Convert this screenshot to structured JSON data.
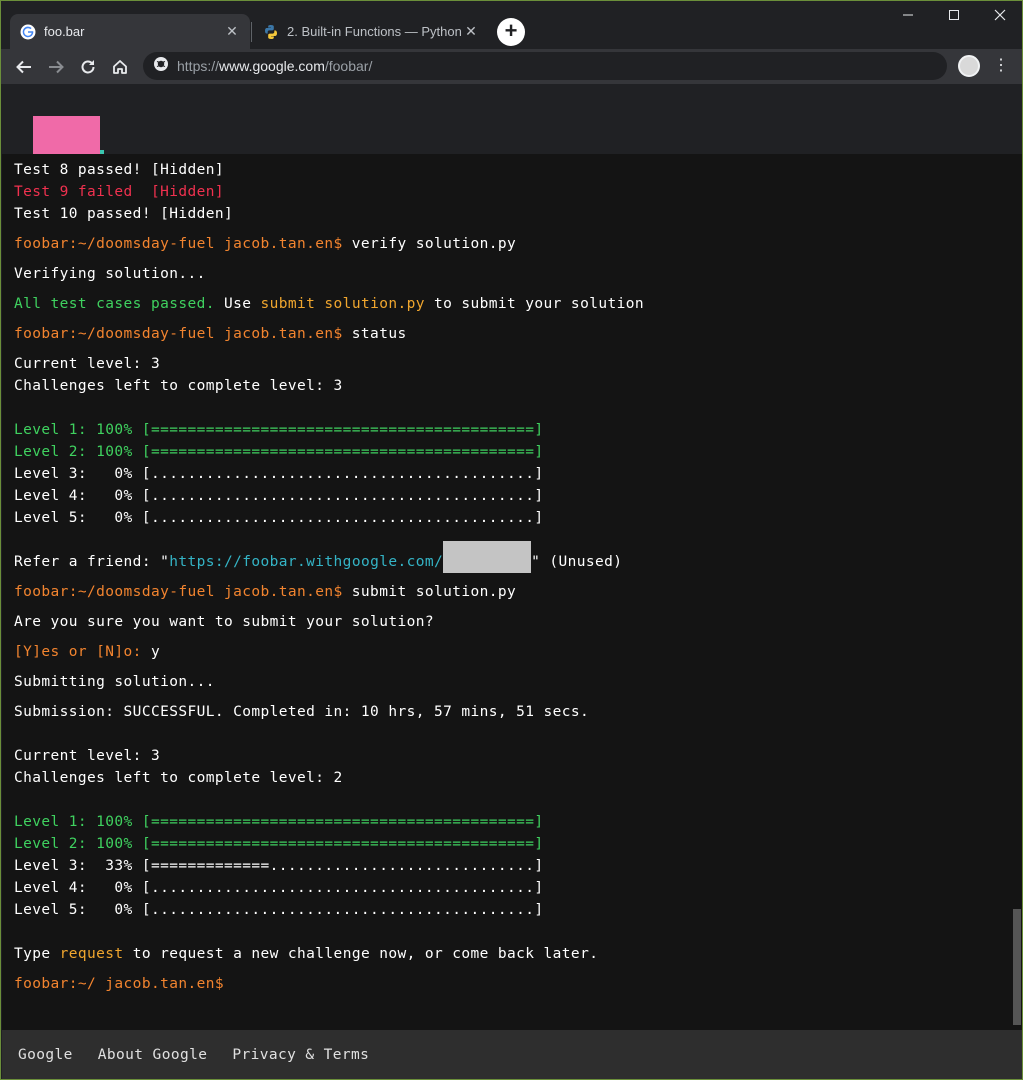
{
  "browser": {
    "tabs": [
      {
        "title": "foo.bar",
        "icon": "google-g-icon",
        "active": true
      },
      {
        "title": "2. Built-in Functions — Python 2.",
        "icon": "python-icon",
        "active": false
      }
    ],
    "url_prefix": "https://",
    "url_host": "www.google.com",
    "url_path": "/foobar/"
  },
  "terminal": {
    "tests": [
      {
        "label": "Test 8 passed! [Hidden]",
        "status": "pass"
      },
      {
        "label": "Test 9 failed  [Hidden]",
        "status": "fail"
      },
      {
        "label": "Test 10 passed! [Hidden]",
        "status": "pass"
      }
    ],
    "prompt": "foobar:~/doomsday-fuel jacob.tan.en$",
    "cmd_verify": " verify solution.py",
    "verifying": "Verifying solution...",
    "all_passed": "All test cases passed.",
    "use_text": " Use ",
    "submit_cmd_hint": "submit solution.py",
    "to_submit_text": " to submit your solution",
    "cmd_status": " status",
    "status1": {
      "current_level": "Current level: 3",
      "challenges_left": "Challenges left to complete level: 3",
      "levels": [
        {
          "text": "Level 1: 100% [==========================================]",
          "complete": true
        },
        {
          "text": "Level 2: 100% [==========================================]",
          "complete": true
        },
        {
          "text": "Level 3:   0% [..........................................]",
          "complete": false
        },
        {
          "text": "Level 4:   0% [..........................................]",
          "complete": false
        },
        {
          "text": "Level 5:   0% [..........................................]",
          "complete": false
        }
      ]
    },
    "refer_prefix": "Refer a friend: \"",
    "refer_url": "https://foobar.withgoogle.com/",
    "refer_suffix": "\" (Unused)",
    "cmd_submit": " submit solution.py",
    "confirm_question": "Are you sure you want to submit your solution?",
    "yes_no_prompt": "[Y]es or [N]o:",
    "yes_answer": " y",
    "submitting": "Submitting solution...",
    "submission_result": "Submission: SUCCESSFUL. Completed in: 10 hrs, 57 mins, 51 secs.",
    "status2": {
      "current_level": "Current level: 3",
      "challenges_left": "Challenges left to complete level: 2",
      "levels": [
        {
          "text": "Level 1: 100% [==========================================]",
          "complete": true
        },
        {
          "text": "Level 2: 100% [==========================================]",
          "complete": true
        },
        {
          "text": "Level 3:  33% [=============.............................]",
          "complete": false
        },
        {
          "text": "Level 4:   0% [..........................................]",
          "complete": false
        },
        {
          "text": "Level 5:   0% [..........................................]",
          "complete": false
        }
      ]
    },
    "type_prefix": "Type ",
    "request_word": "request",
    "type_suffix": " to request a new challenge now, or come back later.",
    "final_prompt": "foobar:~/ jacob.tan.en$"
  },
  "footer": {
    "links": [
      "Google",
      "About Google",
      "Privacy & Terms"
    ]
  },
  "colors": {
    "prompt": "#f2842f",
    "pass_green": "#3fd15f",
    "fail_red": "#f0314f",
    "hint_yellow": "#f0a62e",
    "link_cyan": "#34b4c6",
    "logo_pink": "#f06aa8"
  }
}
